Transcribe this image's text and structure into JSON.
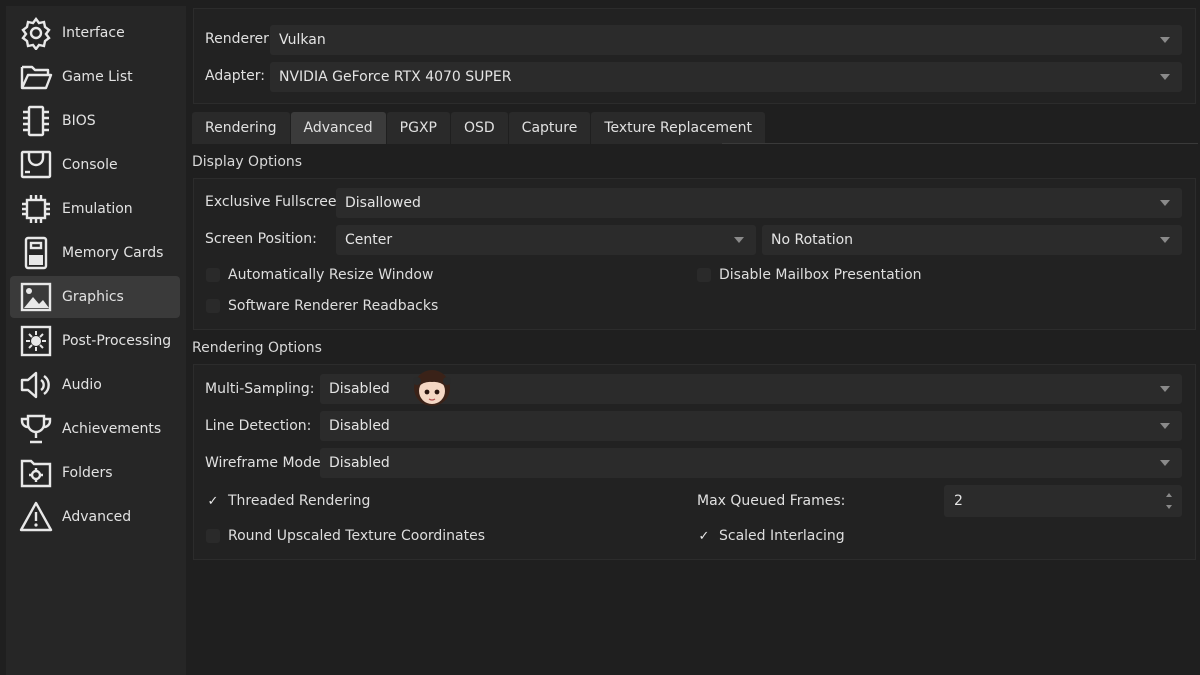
{
  "sidebar": {
    "items": [
      {
        "label": "Interface",
        "icon": "gear-icon"
      },
      {
        "label": "Game List",
        "icon": "folder-open-icon"
      },
      {
        "label": "BIOS",
        "icon": "chip-icon"
      },
      {
        "label": "Console",
        "icon": "console-icon"
      },
      {
        "label": "Emulation",
        "icon": "cpu-icon"
      },
      {
        "label": "Memory Cards",
        "icon": "memory-card-icon"
      },
      {
        "label": "Graphics",
        "icon": "image-icon"
      },
      {
        "label": "Post-Processing",
        "icon": "sun-filter-icon"
      },
      {
        "label": "Audio",
        "icon": "speaker-icon"
      },
      {
        "label": "Achievements",
        "icon": "trophy-icon"
      },
      {
        "label": "Folders",
        "icon": "folder-settings-icon"
      },
      {
        "label": "Advanced",
        "icon": "warning-icon"
      }
    ],
    "active": "Graphics"
  },
  "renderer": {
    "renderer_label": "Renderer:",
    "renderer_value": "Vulkan",
    "adapter_label": "Adapter:",
    "adapter_value": "NVIDIA GeForce RTX 4070 SUPER"
  },
  "tabs": [
    {
      "label": "Rendering"
    },
    {
      "label": "Advanced"
    },
    {
      "label": "PGXP"
    },
    {
      "label": "OSD"
    },
    {
      "label": "Capture"
    },
    {
      "label": "Texture Replacement"
    }
  ],
  "active_tab": "Advanced",
  "display_options": {
    "title": "Display Options",
    "exclusive_fullscreen_label": "Exclusive Fullscreen:",
    "exclusive_fullscreen_value": "Disallowed",
    "screen_position_label": "Screen Position:",
    "screen_position_value": "Center",
    "rotation_value": "No Rotation",
    "auto_resize_label": "Automatically Resize Window",
    "auto_resize_checked": false,
    "disable_mailbox_label": "Disable Mailbox Presentation",
    "disable_mailbox_checked": false,
    "software_readbacks_label": "Software Renderer Readbacks",
    "software_readbacks_checked": false
  },
  "rendering_options": {
    "title": "Rendering Options",
    "multisampling_label": "Multi-Sampling:",
    "multisampling_value": "Disabled",
    "line_detection_label": "Line Detection:",
    "line_detection_value": "Disabled",
    "wireframe_label": "Wireframe Mode:",
    "wireframe_value": "Disabled",
    "threaded_label": "Threaded Rendering",
    "threaded_checked": true,
    "max_queued_label": "Max Queued Frames:",
    "max_queued_value": "2",
    "round_upscaled_label": "Round Upscaled Texture Coordinates",
    "round_upscaled_checked": false,
    "scaled_interlacing_label": "Scaled Interlacing",
    "scaled_interlacing_checked": true
  },
  "colors": {
    "background": "#1f1f1f",
    "sidebar": "#262626",
    "active_item": "#3a3a3a",
    "control": "#2b2b2b",
    "text": "#dcdcdc"
  }
}
